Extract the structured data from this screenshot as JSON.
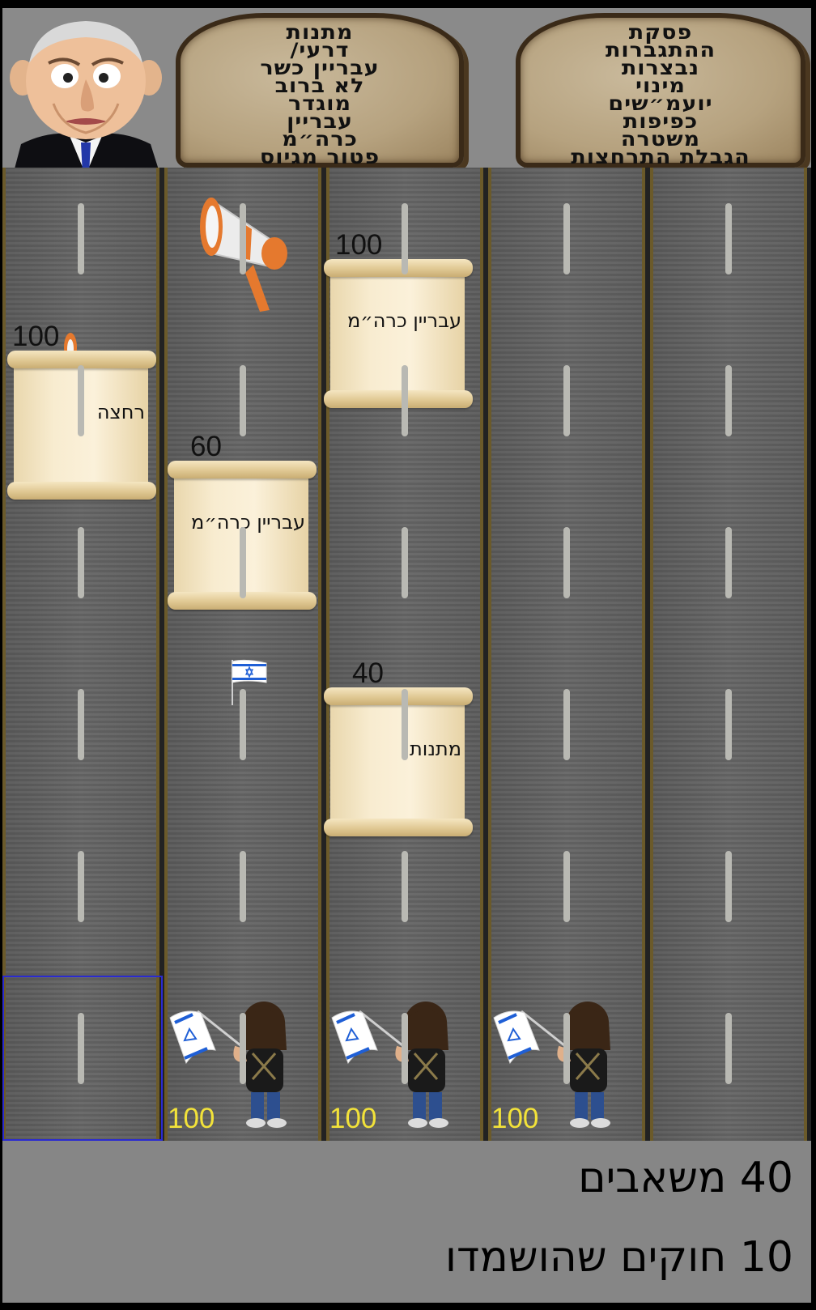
{
  "header": {
    "left_tablet": [
      "מתנות",
      "דרעי/",
      "עבריין כשר",
      "לא ברוב",
      "מוגדר",
      "עבריין",
      "כרה״מ",
      "פטור מגיוס"
    ],
    "right_tablet": [
      "פסקת",
      "ההתגברות",
      "נבצרות",
      "מינוי",
      "יועמ״שים",
      "כפיפות",
      "משטרה",
      "הגבלת התרחצות"
    ]
  },
  "scrolls": [
    {
      "label": "עבריין כרה״מ",
      "hp": "100"
    },
    {
      "label": "רחצה",
      "hp": "100"
    },
    {
      "label": "עבריין כרה״מ",
      "hp": "60"
    },
    {
      "label": "מתנות",
      "hp": "40"
    }
  ],
  "protesters": [
    {
      "hp": "100"
    },
    {
      "hp": "100"
    },
    {
      "hp": "100"
    }
  ],
  "stats": {
    "resources": "40 משאבים",
    "destroyed": "10 חוקים שהושמדו"
  },
  "colors": {
    "hp_protester": "#f2e23a",
    "selection": "#2a2ad0",
    "road": "#5f5f5f",
    "footer": "#868686"
  },
  "icons": [
    "megaphone-icon",
    "israel-flag-icon",
    "protester-icon",
    "caricature-portrait"
  ]
}
